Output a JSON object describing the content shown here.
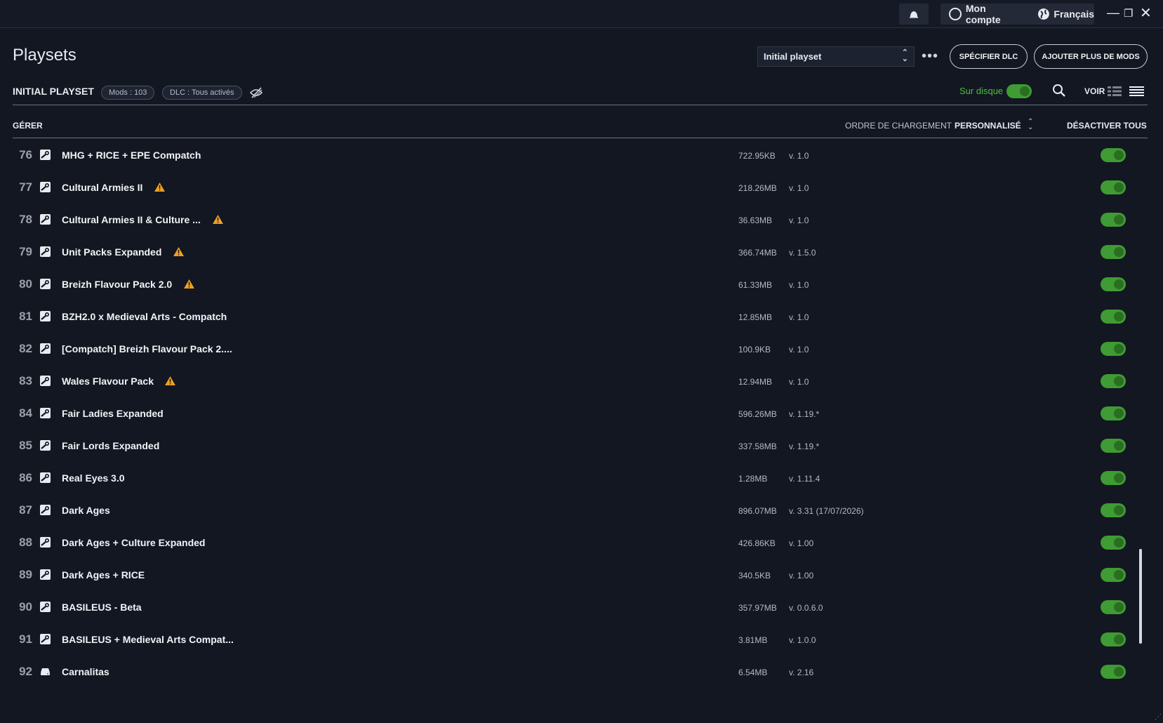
{
  "topbar": {
    "account_label": "Mon compte",
    "language_label": "Français"
  },
  "header": {
    "title": "Playsets",
    "playset_select": "Initial playset",
    "more_icon": "ellipsis-icon",
    "specify_dlc": "SPÉCIFIER DLC",
    "add_mods": "AJOUTER PLUS DE MODS"
  },
  "subheader": {
    "playset_name": "INITIAL PLAYSET",
    "mods_pill": "Mods : 103",
    "dlc_pill": "DLC : Tous activés",
    "on_disk_label": "Sur disque",
    "view_label": "VOIR"
  },
  "columns": {
    "manage": "GÉRER",
    "load_order_label": "ORDRE DE CHARGEMENT",
    "load_order_value": "PERSONNALISÉ",
    "disable_all": "DÉSACTIVER TOUS"
  },
  "colors": {
    "accent_green": "#3f9b33",
    "warning": "#f0a020",
    "background": "#131722"
  },
  "mods": [
    {
      "num": "76",
      "source": "steam-icon",
      "name": "MHG + RICE + EPE Compatch",
      "warning": false,
      "size": "722.95KB",
      "version": "v. 1.0",
      "enabled": true
    },
    {
      "num": "77",
      "source": "steam-icon",
      "name": "Cultural Armies II",
      "warning": true,
      "size": "218.26MB",
      "version": "v. 1.0",
      "enabled": true
    },
    {
      "num": "78",
      "source": "steam-icon",
      "name": "Cultural Armies II & Culture ...",
      "warning": true,
      "size": "36.63MB",
      "version": "v. 1.0",
      "enabled": true
    },
    {
      "num": "79",
      "source": "steam-icon",
      "name": "Unit Packs Expanded",
      "warning": true,
      "size": "366.74MB",
      "version": "v. 1.5.0",
      "enabled": true
    },
    {
      "num": "80",
      "source": "steam-icon",
      "name": "Breizh Flavour Pack 2.0",
      "warning": true,
      "size": "61.33MB",
      "version": "v. 1.0",
      "enabled": true
    },
    {
      "num": "81",
      "source": "steam-icon",
      "name": "BZH2.0 x Medieval Arts - Compatch",
      "warning": false,
      "size": "12.85MB",
      "version": "v. 1.0",
      "enabled": true
    },
    {
      "num": "82",
      "source": "steam-icon",
      "name": "[Compatch] Breizh Flavour Pack 2....",
      "warning": false,
      "size": "100.9KB",
      "version": "v. 1.0",
      "enabled": true
    },
    {
      "num": "83",
      "source": "steam-icon",
      "name": "Wales Flavour Pack",
      "warning": true,
      "size": "12.94MB",
      "version": "v. 1.0",
      "enabled": true
    },
    {
      "num": "84",
      "source": "steam-icon",
      "name": "Fair Ladies Expanded",
      "warning": false,
      "size": "596.26MB",
      "version": "v. 1.19.*",
      "enabled": true
    },
    {
      "num": "85",
      "source": "steam-icon",
      "name": "Fair Lords Expanded",
      "warning": false,
      "size": "337.58MB",
      "version": "v. 1.19.*",
      "enabled": true
    },
    {
      "num": "86",
      "source": "steam-icon",
      "name": "Real Eyes 3.0",
      "warning": false,
      "size": "1.28MB",
      "version": "v. 1.11.4",
      "enabled": true
    },
    {
      "num": "87",
      "source": "steam-icon",
      "name": "Dark Ages",
      "warning": false,
      "size": "896.07MB",
      "version": "v. 3.31 (17/07/2026)",
      "enabled": true
    },
    {
      "num": "88",
      "source": "steam-icon",
      "name": "Dark Ages + Culture Expanded",
      "warning": false,
      "size": "426.86KB",
      "version": "v. 1.00",
      "enabled": true
    },
    {
      "num": "89",
      "source": "steam-icon",
      "name": "Dark Ages + RICE",
      "warning": false,
      "size": "340.5KB",
      "version": "v. 1.00",
      "enabled": true
    },
    {
      "num": "90",
      "source": "steam-icon",
      "name": "BASILEUS - Beta",
      "warning": false,
      "size": "357.97MB",
      "version": "v. 0.0.6.0",
      "enabled": true
    },
    {
      "num": "91",
      "source": "steam-icon",
      "name": "BASILEUS + Medieval Arts Compat...",
      "warning": false,
      "size": "3.81MB",
      "version": "v. 1.0.0",
      "enabled": true
    },
    {
      "num": "92",
      "source": "local-disk-icon",
      "name": "Carnalitas",
      "warning": false,
      "size": "6.54MB",
      "version": "v. 2.16",
      "enabled": true
    }
  ]
}
